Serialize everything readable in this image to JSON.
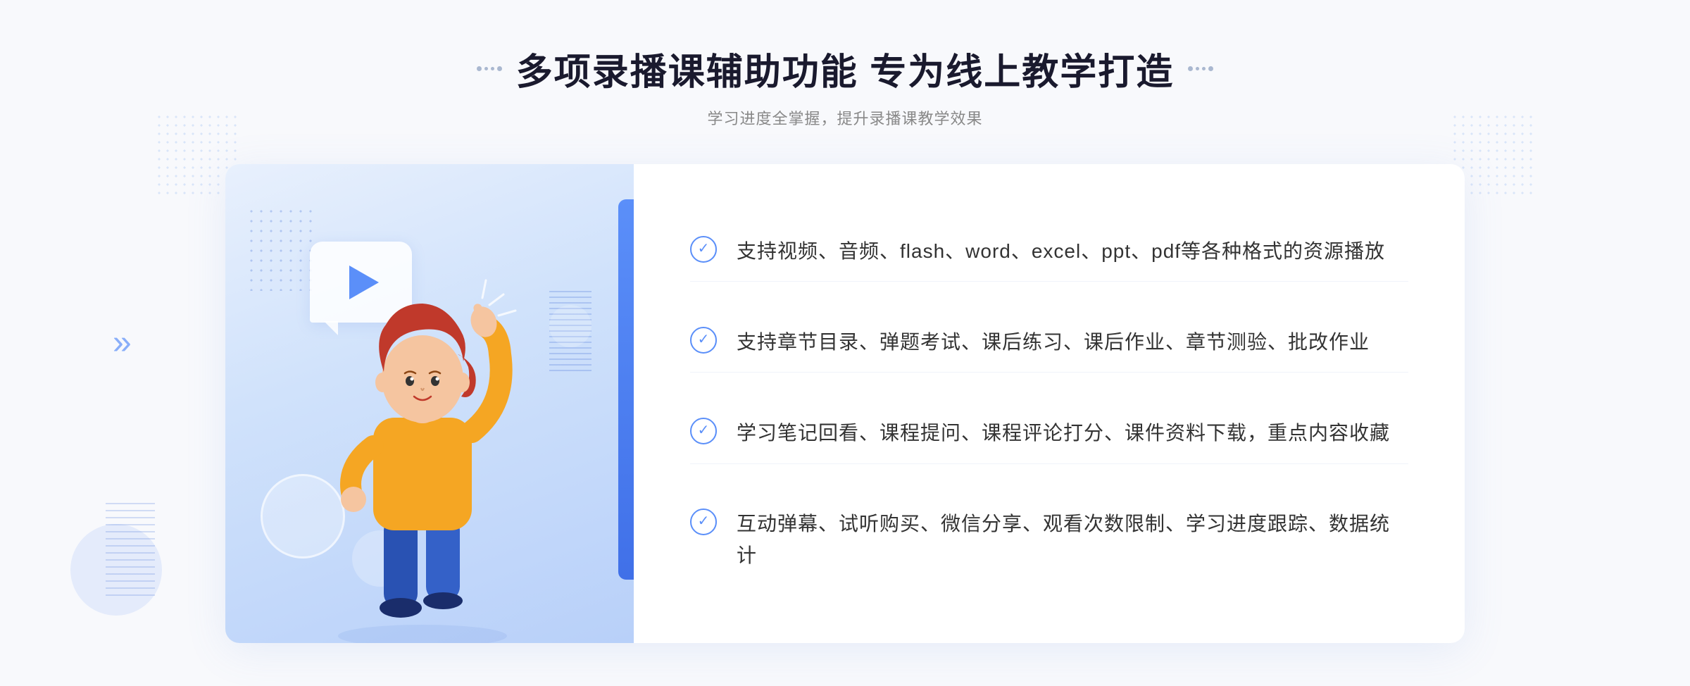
{
  "page": {
    "background": "#f8f9fc"
  },
  "header": {
    "title": "多项录播课辅助功能 专为线上教学打造",
    "subtitle": "学习进度全掌握，提升录播课教学效果"
  },
  "features": [
    {
      "id": "feature-1",
      "text": "支持视频、音频、flash、word、excel、ppt、pdf等各种格式的资源播放"
    },
    {
      "id": "feature-2",
      "text": "支持章节目录、弹题考试、课后练习、课后作业、章节测验、批改作业"
    },
    {
      "id": "feature-3",
      "text": "学习笔记回看、课程提问、课程评论打分、课件资料下载，重点内容收藏"
    },
    {
      "id": "feature-4",
      "text": "互动弹幕、试听购买、微信分享、观看次数限制、学习进度跟踪、数据统计"
    }
  ],
  "icons": {
    "check": "✓",
    "chevron_left": "«",
    "play": "▶"
  }
}
